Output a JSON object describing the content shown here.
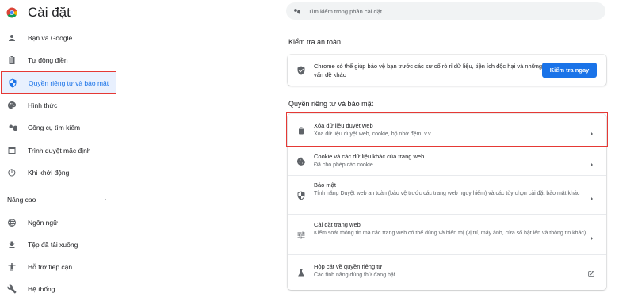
{
  "app": {
    "title": "Cài đặt",
    "logo_icon": "chrome-logo"
  },
  "sidebar": {
    "items": [
      {
        "label": "Bạn và Google",
        "icon": "person-icon"
      },
      {
        "label": "Tự động điền",
        "icon": "clipboard-icon"
      },
      {
        "label": "Quyền riêng tư và bảo mật",
        "icon": "shield-icon",
        "active": true
      },
      {
        "label": "Hình thức",
        "icon": "palette-icon"
      },
      {
        "label": "Công cụ tìm kiếm",
        "icon": "search-icon"
      },
      {
        "label": "Trình duyệt mặc định",
        "icon": "browser-icon"
      },
      {
        "label": "Khi khởi động",
        "icon": "power-icon"
      }
    ],
    "advanced": {
      "label": "Nâng cao",
      "items": [
        {
          "label": "Ngôn ngữ",
          "icon": "globe-icon"
        },
        {
          "label": "Tệp đã tải xuống",
          "icon": "download-icon"
        },
        {
          "label": "Hỗ trợ tiếp cận",
          "icon": "accessibility-icon"
        },
        {
          "label": "Hệ thống",
          "icon": "wrench-icon"
        }
      ]
    }
  },
  "search": {
    "placeholder": "Tìm kiếm trong phần cài đặt"
  },
  "safety_check": {
    "heading": "Kiểm tra an toàn",
    "description": "Chrome có thể giúp bảo vệ bạn trước các sự cố rò rỉ dữ liệu, tiện ích độc hại và những vấn đề khác",
    "button": "Kiểm tra ngay"
  },
  "privacy": {
    "heading": "Quyền riêng tư và bảo mật",
    "rows": [
      {
        "title": "Xóa dữ liệu duyệt web",
        "subtitle": "Xóa dữ liệu duyệt web, cookie, bộ nhớ đệm, v.v.",
        "icon": "trash-icon"
      },
      {
        "title": "Cookie và các dữ liệu khác của trang web",
        "subtitle": "Đã cho phép các cookie",
        "icon": "cookie-icon"
      },
      {
        "title": "Bảo mật",
        "subtitle": "Tính năng Duyệt web an toàn (bảo vệ trước các trang web nguy hiểm) và các tùy chọn cài đặt bảo mật khác",
        "icon": "shield-icon"
      },
      {
        "title": "Cài đặt trang web",
        "subtitle": "Kiểm soát thông tin mà các trang web có thể dùng và hiển thị (vị trí, máy ảnh, cửa sổ bật lên và thông tin khác)",
        "icon": "tune-icon"
      },
      {
        "title": "Hộp cát về quyền riêng tư",
        "subtitle": "Các tính năng dùng thử đang bật",
        "icon": "flask-icon"
      }
    ]
  },
  "colors": {
    "accent": "#1a73e8",
    "highlight": "#e53935",
    "active_bg": "#e8f0fe"
  }
}
